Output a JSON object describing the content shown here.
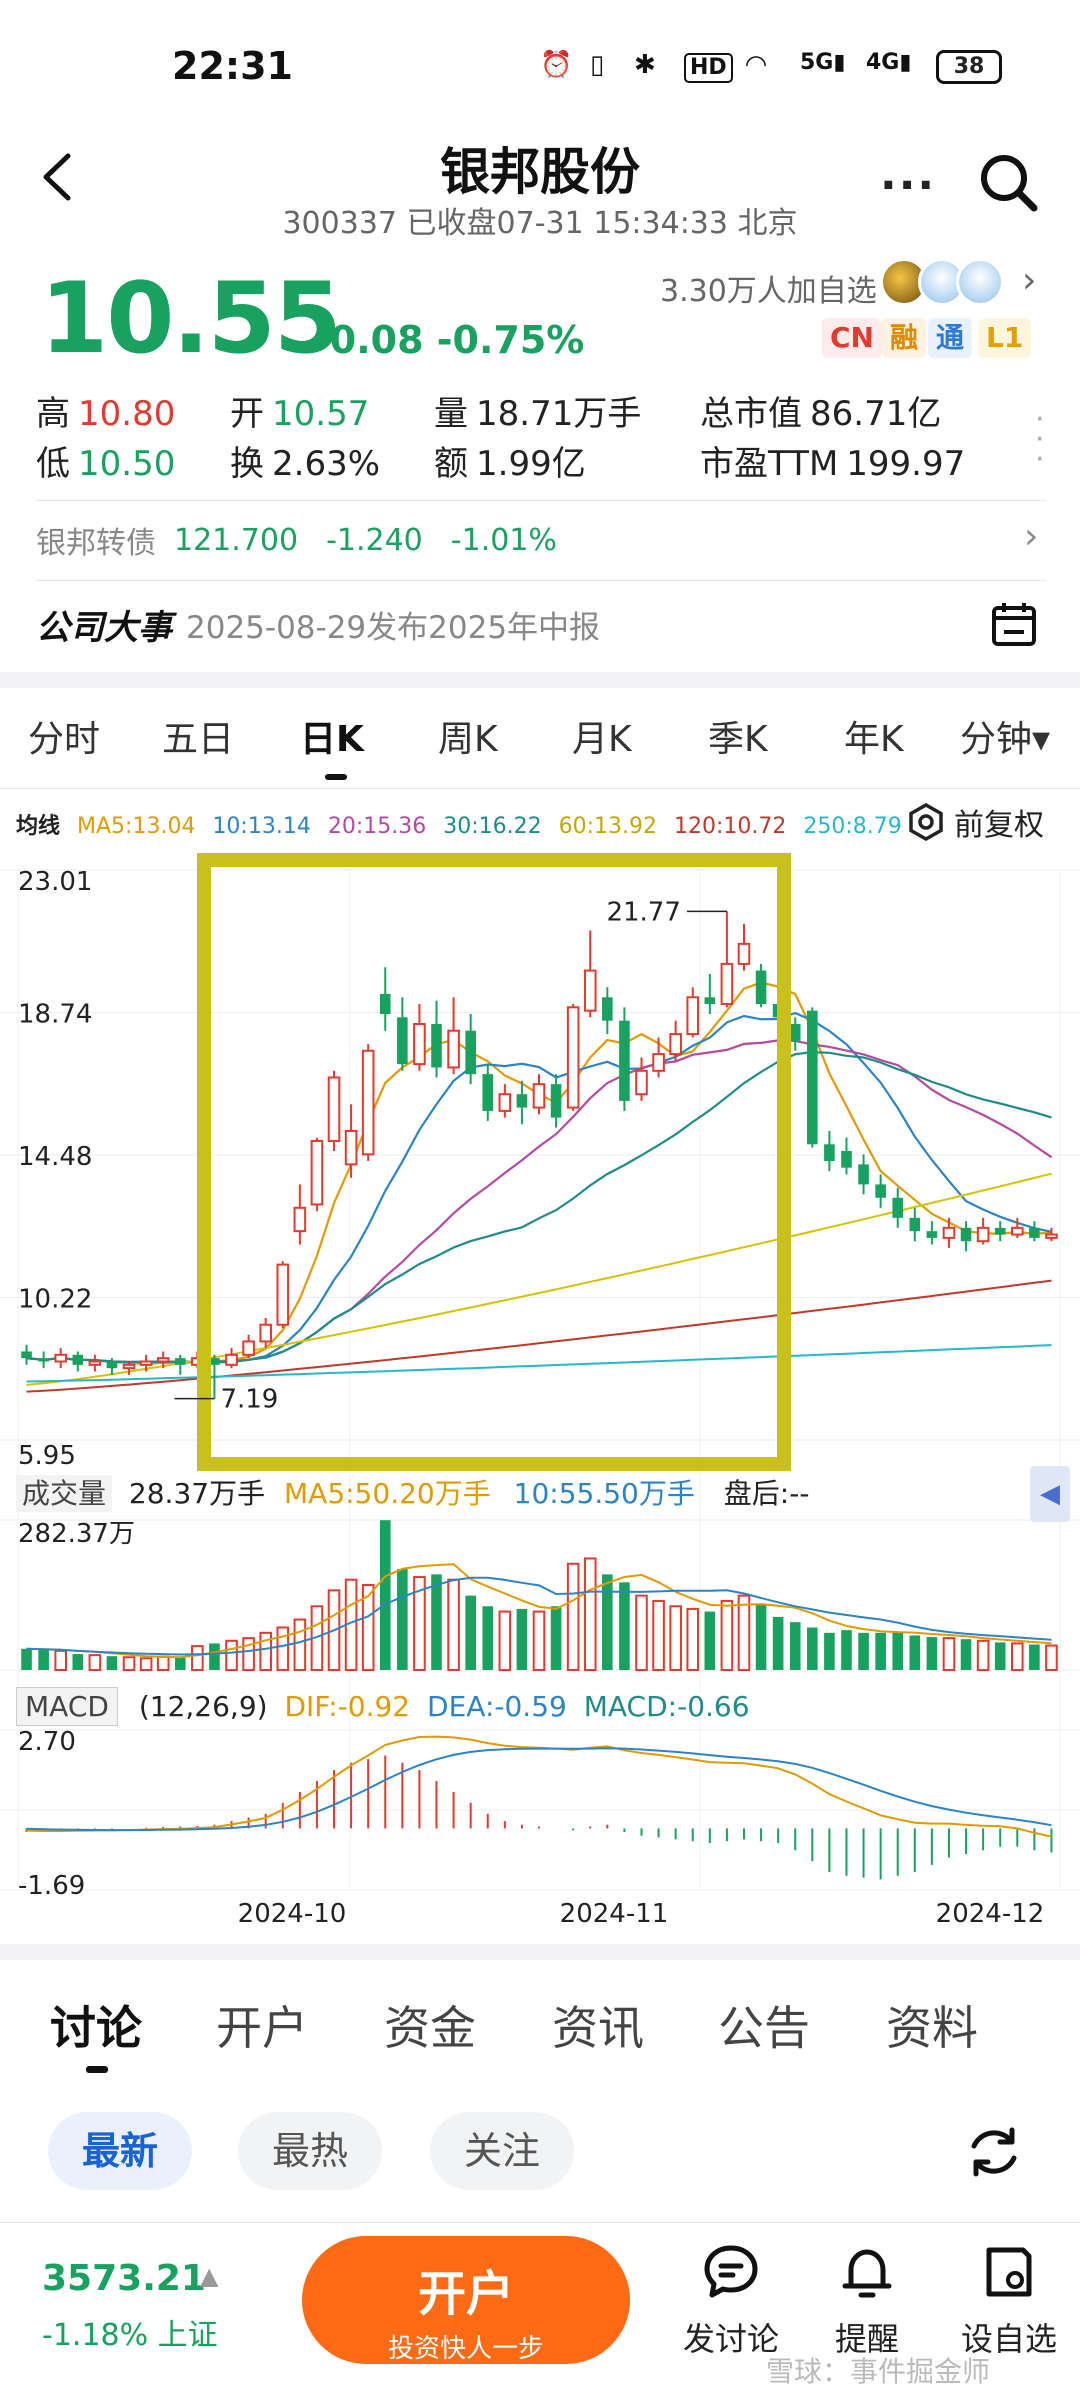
{
  "status": {
    "time": "22:31",
    "hd": "HD",
    "net1": "5G",
    "net2": "4G",
    "battery": "38"
  },
  "header": {
    "title": "银邦股份",
    "subtitle": "300337 已收盘07-31 15:34:33 北京"
  },
  "quote": {
    "price": "10.55",
    "change": "-0.08 -0.75%",
    "followers": "3.30万人加自选",
    "tags": [
      "CN",
      "融",
      "通",
      "L1"
    ],
    "stats": {
      "high_label": "高",
      "high": "10.80",
      "low_label": "低",
      "low": "10.50",
      "open_label": "开",
      "open": "10.57",
      "turnover_label": "换",
      "turnover": "2.63%",
      "volume_label": "量",
      "volume": "18.71万手",
      "amount_label": "额",
      "amount": "1.99亿",
      "mktcap_label": "总市值",
      "mktcap": "86.71亿",
      "pe_label": "市盈TTM",
      "pe": "199.97"
    }
  },
  "bond": {
    "name": "银邦转债",
    "price": "121.700",
    "change": "-1.240",
    "pct": "-1.01%"
  },
  "event": {
    "label": "公司大事",
    "text": "2025-08-29发布2025年中报"
  },
  "period_tabs": [
    "分时",
    "五日",
    "日K",
    "周K",
    "月K",
    "季K",
    "年K",
    "分钟▾"
  ],
  "ma_legend": {
    "label": "均线",
    "items": [
      "MA5:13.04",
      "10:13.14",
      "20:15.36",
      "30:16.22",
      "60:13.92",
      "120:10.72",
      "250:8.79"
    ],
    "colors": [
      "#e39a00",
      "#2b84c8",
      "#b54aa0",
      "#1e8c8a",
      "#d6c200",
      "#c0392b",
      "#25b8c8"
    ]
  },
  "adjust_label": "前复权",
  "price_chart": {
    "y_labels": [
      "23.01",
      "18.74",
      "14.48",
      "10.22",
      "5.95"
    ],
    "max_label": "21.77",
    "min_label": "7.19"
  },
  "volume": {
    "label": "成交量",
    "value": "28.37万手",
    "ma5": "MA5:50.20万手",
    "ma10": "10:55.50万手",
    "after": "盘后:--",
    "max_label": "282.37万"
  },
  "macd": {
    "label": "MACD",
    "params": "(12,26,9)",
    "dif": "DIF:-0.92",
    "dea": "DEA:-0.59",
    "macd": "MACD:-0.66",
    "top_label": "2.70",
    "bottom_label": "-1.69"
  },
  "x_axis": [
    "2024-10",
    "2024-11",
    "2024-12"
  ],
  "chart_data": {
    "type": "candlestick",
    "title": "",
    "ylim": [
      5.95,
      23.01
    ],
    "highlight_color": "#c8c11b",
    "candles": [
      [
        8.6,
        8.4,
        8.8,
        8.2
      ],
      [
        8.4,
        8.3,
        8.6,
        8.1
      ],
      [
        8.3,
        8.5,
        8.7,
        8.1
      ],
      [
        8.5,
        8.2,
        8.6,
        8.0
      ],
      [
        8.2,
        8.3,
        8.5,
        8.0
      ],
      [
        8.3,
        8.1,
        8.4,
        7.9
      ],
      [
        8.1,
        8.2,
        8.3,
        7.9
      ],
      [
        8.2,
        8.3,
        8.5,
        8.0
      ],
      [
        8.3,
        8.4,
        8.6,
        8.1
      ],
      [
        8.4,
        8.2,
        8.5,
        7.9
      ],
      [
        8.2,
        8.4,
        8.6,
        8.1
      ],
      [
        8.4,
        8.2,
        8.5,
        7.19
      ],
      [
        8.2,
        8.5,
        8.7,
        8.1
      ],
      [
        8.5,
        8.9,
        9.1,
        8.4
      ],
      [
        8.9,
        9.4,
        9.6,
        8.7
      ],
      [
        9.4,
        11.2,
        11.3,
        9.3
      ],
      [
        12.2,
        12.9,
        13.6,
        11.8
      ],
      [
        13.0,
        14.9,
        15.0,
        12.8
      ],
      [
        14.9,
        16.8,
        17.0,
        14.6
      ],
      [
        14.2,
        15.2,
        16.0,
        13.8
      ],
      [
        14.5,
        17.6,
        17.8,
        14.3
      ],
      [
        19.3,
        18.7,
        20.1,
        18.2
      ],
      [
        18.6,
        17.2,
        19.2,
        17.0
      ],
      [
        17.2,
        18.4,
        19.0,
        17.0
      ],
      [
        18.4,
        17.1,
        19.1,
        16.8
      ],
      [
        17.1,
        18.2,
        19.2,
        16.9
      ],
      [
        18.2,
        16.9,
        18.7,
        16.6
      ],
      [
        16.9,
        15.8,
        17.2,
        15.5
      ],
      [
        15.8,
        16.3,
        16.6,
        15.6
      ],
      [
        16.3,
        15.9,
        16.7,
        15.4
      ],
      [
        15.9,
        16.6,
        16.9,
        15.7
      ],
      [
        16.6,
        15.6,
        16.9,
        15.3
      ],
      [
        15.9,
        18.9,
        19.0,
        15.8
      ],
      [
        18.8,
        20.0,
        21.2,
        18.6
      ],
      [
        19.2,
        18.5,
        19.5,
        18.1
      ],
      [
        18.5,
        16.1,
        18.9,
        15.8
      ],
      [
        16.3,
        17.0,
        17.4,
        16.1
      ],
      [
        17.0,
        17.5,
        18.0,
        16.8
      ],
      [
        17.5,
        18.1,
        18.5,
        17.3
      ],
      [
        18.1,
        19.2,
        19.5,
        18.0
      ],
      [
        19.2,
        19.0,
        19.9,
        18.7
      ],
      [
        19.0,
        20.2,
        21.77,
        18.9
      ],
      [
        20.2,
        20.8,
        21.4,
        20.0
      ],
      [
        20.0,
        19.0,
        20.2,
        18.9
      ],
      [
        19.0,
        18.6,
        19.2,
        18.2
      ],
      [
        18.4,
        17.9,
        18.6,
        17.6
      ],
      [
        18.8,
        14.8,
        18.9,
        14.7
      ],
      [
        14.8,
        14.3,
        15.2,
        14.0
      ],
      [
        14.6,
        14.1,
        15.0,
        13.9
      ],
      [
        14.2,
        13.6,
        14.5,
        13.3
      ],
      [
        13.6,
        13.2,
        13.9,
        12.9
      ],
      [
        13.2,
        12.6,
        13.5,
        12.3
      ],
      [
        12.6,
        12.2,
        12.9,
        11.9
      ],
      [
        12.2,
        12.0,
        12.5,
        11.8
      ],
      [
        12.0,
        12.3,
        12.6,
        11.7
      ],
      [
        12.3,
        11.9,
        12.5,
        11.6
      ],
      [
        11.9,
        12.3,
        12.6,
        11.8
      ],
      [
        12.3,
        12.1,
        12.5,
        11.9
      ],
      [
        12.1,
        12.3,
        12.6,
        12.0
      ],
      [
        12.3,
        12.0,
        12.5,
        11.9
      ],
      [
        12.0,
        12.1,
        12.3,
        11.9
      ]
    ],
    "volume_ylim": [
      0,
      282.37
    ],
    "volumes": [
      40,
      38,
      36,
      30,
      28,
      26,
      24,
      22,
      25,
      23,
      45,
      50,
      55,
      60,
      70,
      80,
      95,
      120,
      150,
      170,
      160,
      282,
      190,
      175,
      180,
      170,
      140,
      120,
      110,
      115,
      110,
      120,
      200,
      210,
      180,
      165,
      140,
      130,
      120,
      115,
      110,
      130,
      140,
      125,
      100,
      90,
      80,
      70,
      75,
      70,
      70,
      72,
      65,
      62,
      60,
      58,
      55,
      52,
      50,
      48,
      46
    ],
    "macd_ylim": [
      -1.69,
      2.7
    ],
    "macd_hist": [
      -0.1,
      -0.1,
      -0.08,
      -0.05,
      -0.03,
      -0.02,
      0,
      0.02,
      0.04,
      0.05,
      0.07,
      0.1,
      0.2,
      0.3,
      0.4,
      0.7,
      1.0,
      1.3,
      1.6,
      1.8,
      1.9,
      2.0,
      1.8,
      1.6,
      1.3,
      1.0,
      0.7,
      0.4,
      0.2,
      0.1,
      0.05,
      0,
      -0.05,
      0.05,
      0.1,
      -0.1,
      -0.2,
      -0.25,
      -0.3,
      -0.35,
      -0.4,
      -0.35,
      -0.3,
      -0.35,
      -0.4,
      -0.6,
      -0.9,
      -1.2,
      -1.3,
      -1.35,
      -1.4,
      -1.3,
      -1.2,
      -1.0,
      -0.8,
      -0.7,
      -0.6,
      -0.5,
      -0.5,
      -0.6,
      -0.66
    ]
  },
  "bottom_tabs": [
    "讨论",
    "开户",
    "资金",
    "资讯",
    "公告",
    "资料"
  ],
  "filters": [
    "最新",
    "最热",
    "关注"
  ],
  "bottom_bar": {
    "index_value": "3573.21",
    "index_change": "-1.18% 上证",
    "open_title": "开户",
    "open_sub": "投资快人一步",
    "post_label": "发讨论",
    "alert_label": "提醒",
    "watch_label": "设自选",
    "watermark": "雪球：事件掘金师"
  }
}
